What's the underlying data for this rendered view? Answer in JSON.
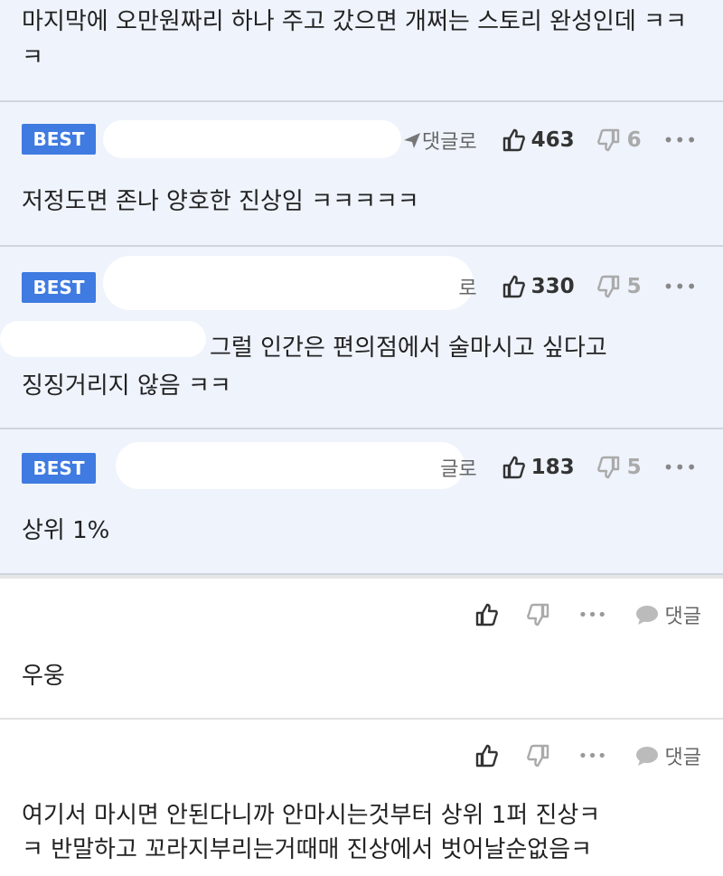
{
  "top": {
    "text": "마지막에 오만원짜리 하나 주고 갔으면 개쩌는 스토리 완성인데 ㅋㅋㅋ"
  },
  "badge_label": "BEST",
  "reply_label": "댓글로",
  "best_comments": [
    {
      "likes": "463",
      "dislikes": "6",
      "text": "저정도면 존나 양호한 진상임 ㅋㅋㅋㅋㅋ",
      "reply_fragment": "댓글로"
    },
    {
      "likes": "330",
      "dislikes": "5",
      "text_line1": "그럴 인간은 편의점에서 술마시고 싶다고",
      "text_line2": "징징거리지 않음 ㅋㅋ",
      "reply_fragment": "로"
    },
    {
      "likes": "183",
      "dislikes": "5",
      "text": "상위 1%",
      "reply_fragment": "글로"
    }
  ],
  "more_label": "•••",
  "comments": [
    {
      "reply_label": "댓글",
      "text": "우웅"
    },
    {
      "reply_label": "댓글",
      "text_line1": "여기서 마시면 안된다니까 안마시는것부터 상위 1퍼 진상ㅋ",
      "text_line2": "ㅋ 반말하고 꼬라지부리는거때매 진상에서 벗어날순없음ㅋ"
    }
  ]
}
